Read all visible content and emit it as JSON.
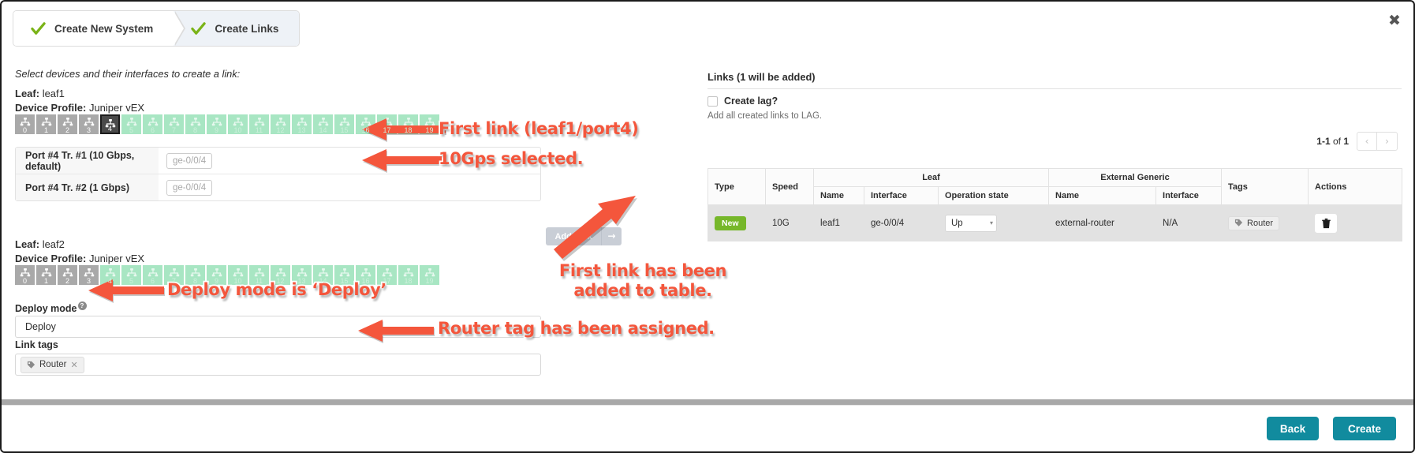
{
  "wizard": {
    "steps": [
      {
        "label": "Create New System",
        "state": "done"
      },
      {
        "label": "Create Links",
        "state": "active"
      }
    ]
  },
  "close_label": "✖",
  "left_panel": {
    "lead_text": "Select devices and their interfaces to create a link:",
    "leaf1": {
      "leaf_key": "Leaf:",
      "leaf_value": "leaf1",
      "profile_key": "Device Profile:",
      "profile_value": "Juniper vEX",
      "ports": [
        {
          "n": "0",
          "state": "gray"
        },
        {
          "n": "1",
          "state": "gray"
        },
        {
          "n": "2",
          "state": "gray"
        },
        {
          "n": "3",
          "state": "gray"
        },
        {
          "n": "4",
          "state": "sel"
        },
        {
          "n": "5",
          "state": "green"
        },
        {
          "n": "6",
          "state": "green"
        },
        {
          "n": "7",
          "state": "green"
        },
        {
          "n": "8",
          "state": "green"
        },
        {
          "n": "9",
          "state": "green"
        },
        {
          "n": "10",
          "state": "green"
        },
        {
          "n": "11",
          "state": "green"
        },
        {
          "n": "12",
          "state": "green"
        },
        {
          "n": "13",
          "state": "green"
        },
        {
          "n": "14",
          "state": "green"
        },
        {
          "n": "15",
          "state": "green"
        },
        {
          "n": "16",
          "state": "green"
        },
        {
          "n": "17",
          "state": "green"
        },
        {
          "n": "18",
          "state": "green"
        },
        {
          "n": "19",
          "state": "green"
        }
      ]
    },
    "leaf2": {
      "leaf_key": "Leaf:",
      "leaf_value": "leaf2",
      "profile_key": "Device Profile:",
      "profile_value": "Juniper vEX",
      "ports": [
        {
          "n": "0",
          "state": "gray"
        },
        {
          "n": "1",
          "state": "gray"
        },
        {
          "n": "2",
          "state": "gray"
        },
        {
          "n": "3",
          "state": "gray"
        },
        {
          "n": "4",
          "state": "green"
        },
        {
          "n": "5",
          "state": "green"
        },
        {
          "n": "6",
          "state": "green"
        },
        {
          "n": "7",
          "state": "green"
        },
        {
          "n": "8",
          "state": "green"
        },
        {
          "n": "9",
          "state": "green"
        },
        {
          "n": "10",
          "state": "green"
        },
        {
          "n": "11",
          "state": "green"
        },
        {
          "n": "12",
          "state": "green"
        },
        {
          "n": "13",
          "state": "green"
        },
        {
          "n": "14",
          "state": "green"
        },
        {
          "n": "15",
          "state": "green"
        },
        {
          "n": "16",
          "state": "green"
        },
        {
          "n": "17",
          "state": "green"
        },
        {
          "n": "18",
          "state": "green"
        },
        {
          "n": "19",
          "state": "green"
        }
      ]
    },
    "transforms": [
      {
        "label": "Port #4 Tr. #1 (10 Gbps, default)",
        "placeholder": "ge-0/0/4"
      },
      {
        "label": "Port #4 Tr. #2 (1 Gbps)",
        "placeholder": "ge-0/0/4"
      }
    ],
    "add_link_label": "Add Link",
    "add_link_arrow": "→",
    "deploy_mode": {
      "label": "Deploy mode",
      "value": "Deploy",
      "clear": "✕"
    },
    "link_tags": {
      "label": "Link tags",
      "tags": [
        {
          "name": "Router",
          "remove": "✕"
        }
      ]
    }
  },
  "right_panel": {
    "title": "Links (1 will be added)",
    "create_lag": {
      "label": "Create lag?",
      "checked": false,
      "help": "Add all created links to LAG."
    },
    "pager": {
      "range": "1-1",
      "of": " of ",
      "total": "1",
      "prev": "‹",
      "next": "›"
    },
    "table": {
      "group_headers": [
        {
          "label": "Type",
          "rowspan": 2
        },
        {
          "label": "Speed",
          "rowspan": 2
        },
        {
          "label": "Leaf",
          "colspan": 3
        },
        {
          "label": "External Generic",
          "colspan": 2
        },
        {
          "label": "Tags",
          "rowspan": 2
        },
        {
          "label": "Actions",
          "rowspan": 2
        }
      ],
      "sub_headers": [
        "Name",
        "Interface",
        "Operation state",
        "Name",
        "Interface"
      ],
      "rows": [
        {
          "type": "New",
          "speed": "10G",
          "leaf_name": "leaf1",
          "leaf_interface": "ge-0/0/4",
          "operation_state": "Up",
          "operation_state_caret": "▾",
          "ext_name": "external-router",
          "ext_interface": "N/A",
          "tag": "Router",
          "action": "delete"
        }
      ]
    }
  },
  "footer": {
    "back_label": "Back",
    "create_label": "Create"
  },
  "annotations": [
    {
      "id": "a1",
      "text": "First link (leaf1/port4)"
    },
    {
      "id": "a2",
      "text": "10Gps selected."
    },
    {
      "id": "a3",
      "text": "First link has been\nadded to table."
    },
    {
      "id": "a4",
      "text": "Deploy mode is ‘Deploy’"
    },
    {
      "id": "a5",
      "text": "Router tag has been assigned."
    }
  ],
  "colors": {
    "accent_teal": "#118b9e",
    "badge_green": "#76b72a",
    "port_green": "#a8e6c3",
    "port_gray": "#a9a9a9",
    "annotation_red": "#f4563c"
  }
}
